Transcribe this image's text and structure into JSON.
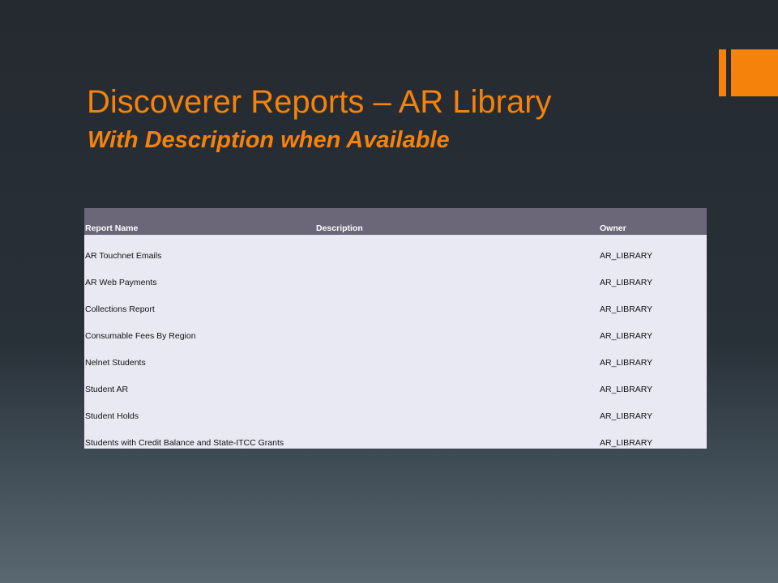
{
  "slide": {
    "title": "Discoverer Reports – AR Library",
    "subtitle": "With Description when Available",
    "accent_color": "#f5820b"
  },
  "table": {
    "headers": [
      "Report Name",
      "Description",
      "Owner"
    ],
    "rows": [
      [
        "AR Touchnet Emails",
        "",
        "AR_LIBRARY"
      ],
      [
        "AR Web Payments",
        "",
        "AR_LIBRARY"
      ],
      [
        "Collections Report",
        "",
        "AR_LIBRARY"
      ],
      [
        "Consumable Fees By Region",
        "",
        "AR_LIBRARY"
      ],
      [
        "Nelnet Students",
        "",
        "AR_LIBRARY"
      ],
      [
        "Student AR",
        "",
        "AR_LIBRARY"
      ],
      [
        "Student Holds",
        "",
        "AR_LIBRARY"
      ],
      [
        "Students with Credit Balance and State-ITCC Grants",
        "",
        "AR_LIBRARY"
      ]
    ]
  }
}
